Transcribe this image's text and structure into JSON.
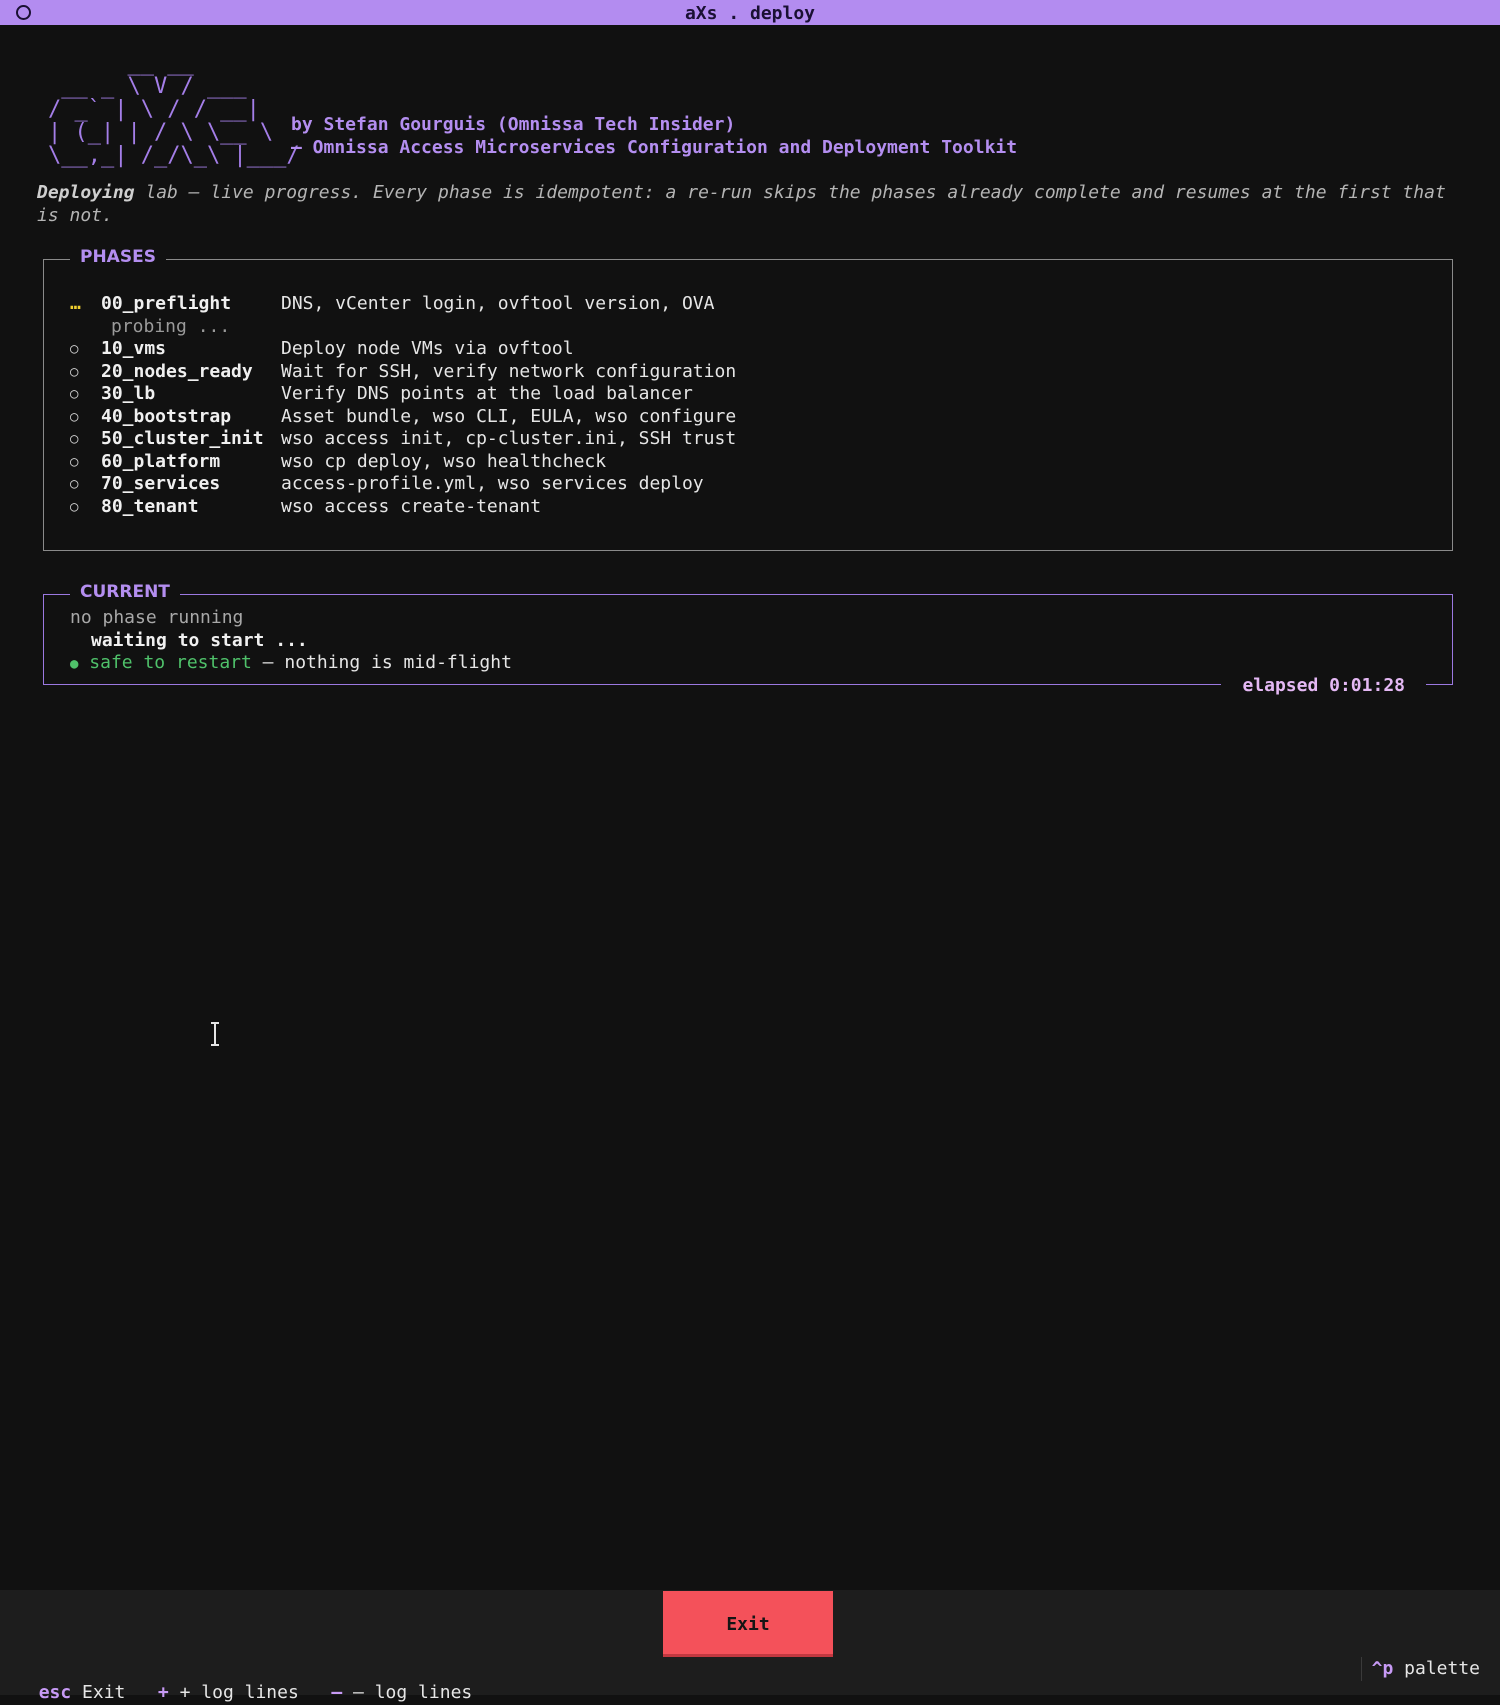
{
  "window": {
    "title": "aXs . deploy"
  },
  "banner": {
    "logo_ascii": "      __ __\n __ _ \\ V / ___\n/ _` | \\ / / __|\n| (_| | / \\ \\__ \\\n\\__,_| /_/\\_\\ |___/",
    "credit_line": "by Stefan Gourguis (Omnissa Tech Insider)",
    "subtitle_line": "– Omnissa Access Microservices Configuration and Deployment Toolkit"
  },
  "intro": {
    "lead": "Deploying",
    "rest": " lab – live progress. Every phase is idempotent: a re-run skips the phases already complete and resumes at the first that is not."
  },
  "phases_panel": {
    "title": "PHASES",
    "running_mark": "…",
    "pending_mark": "○",
    "phases": [
      {
        "name": "00_preflight",
        "description": "DNS, vCenter login, ovftool version, OVA",
        "status": "running",
        "detail": "probing ..."
      },
      {
        "name": "10_vms",
        "description": "Deploy node VMs via ovftool",
        "status": "pending"
      },
      {
        "name": "20_nodes_ready",
        "description": "Wait for SSH, verify network configuration",
        "status": "pending"
      },
      {
        "name": "30_lb",
        "description": "Verify DNS points at the load balancer",
        "status": "pending"
      },
      {
        "name": "40_bootstrap",
        "description": "Asset bundle, wso CLI, EULA, wso configure",
        "status": "pending"
      },
      {
        "name": "50_cluster_init",
        "description": "wso access init, cp-cluster.ini, SSH trust",
        "status": "pending"
      },
      {
        "name": "60_platform",
        "description": "wso cp deploy, wso healthcheck",
        "status": "pending"
      },
      {
        "name": "70_services",
        "description": "access-profile.yml, wso services deploy",
        "status": "pending"
      },
      {
        "name": "80_tenant",
        "description": "wso access create-tenant",
        "status": "pending"
      }
    ]
  },
  "current_panel": {
    "title": "CURRENT",
    "state": "no phase running",
    "waiting": "waiting to start ...",
    "safe_dot": "●",
    "safe_label": "safe to restart",
    "safe_note": " – nothing is mid-flight",
    "elapsed": "elapsed 0:01:28"
  },
  "footer": {
    "exit_button": "Exit",
    "bindings": [
      {
        "key": "esc",
        "label": "Exit"
      },
      {
        "key": "+",
        "label": "+ log lines"
      },
      {
        "key": "–",
        "label": "– log lines"
      }
    ],
    "palette_key": "^p",
    "palette_label": "palette"
  },
  "colors": {
    "accent": "#b38cf0",
    "running": "#f0d030",
    "ok": "#4fc16a",
    "exit_button": "#f4515a"
  }
}
